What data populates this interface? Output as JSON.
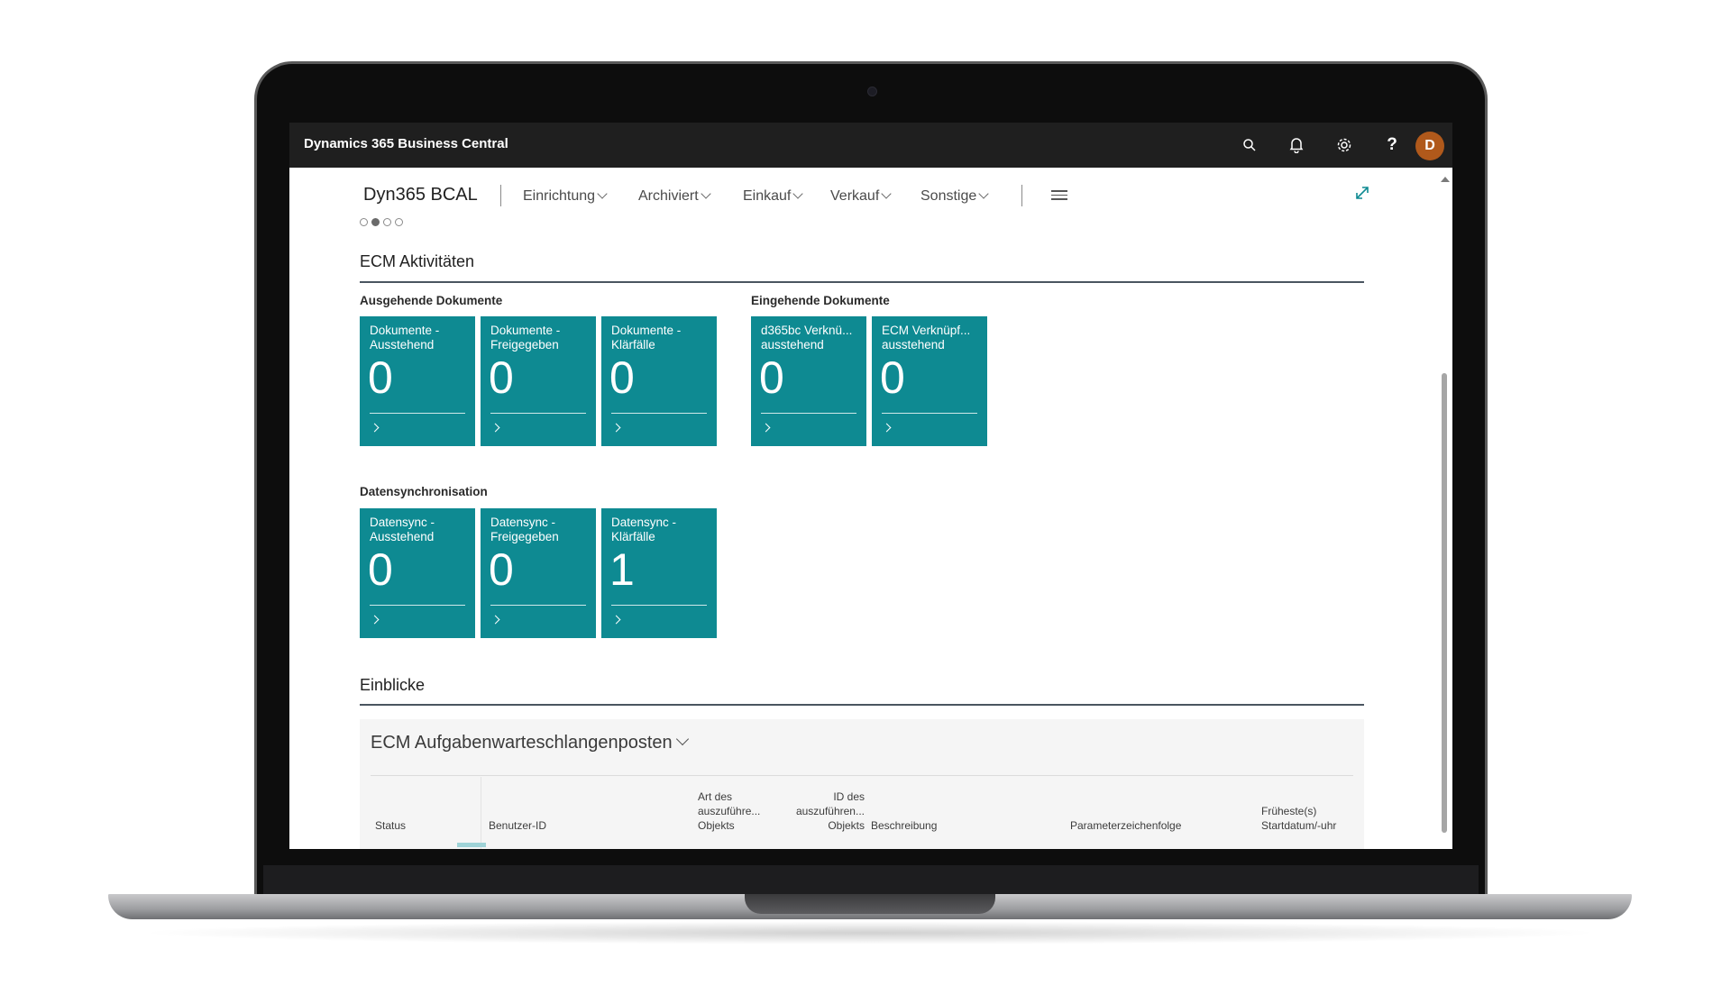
{
  "app": {
    "title": "Dynamics 365 Business Central",
    "avatar_initial": "D",
    "accent_tile": "#0e8a92",
    "header_bg": "#1f1f1f",
    "avatar_bg": "#b0591b"
  },
  "header_icons": [
    "search-icon",
    "bell-icon",
    "gear-icon",
    "help-icon"
  ],
  "nav": {
    "company": "Dyn365 BCAL",
    "items": [
      "Einrichtung",
      "Archiviert",
      "Einkauf",
      "Verkauf",
      "Sonstige"
    ],
    "page_dots": 4,
    "active_dot": 1
  },
  "ecm": {
    "title": "ECM Aktivitäten",
    "groups": [
      {
        "label": "Ausgehende Dokumente",
        "tiles": [
          {
            "label": "Dokumente -\nAusstehend",
            "value": "0"
          },
          {
            "label": "Dokumente -\nFreigegeben",
            "value": "0"
          },
          {
            "label": "Dokumente -\nKlärfälle",
            "value": "0"
          }
        ]
      },
      {
        "label": "Eingehende Dokumente",
        "tiles": [
          {
            "label": "d365bc Verknü...\nausstehend",
            "value": "0"
          },
          {
            "label": "ECM Verknüpf...\nausstehend",
            "value": "0"
          }
        ]
      },
      {
        "label": "Datensynchronisation",
        "tiles": [
          {
            "label": "Datensync -\nAusstehend",
            "value": "0"
          },
          {
            "label": "Datensync -\nFreigegeben",
            "value": "0"
          },
          {
            "label": "Datensync -\nKlärfälle",
            "value": "1"
          }
        ]
      }
    ]
  },
  "insights": {
    "title": "Einblicke",
    "card_title": "ECM Aufgabenwarteschlangenposten",
    "columns": [
      "Status",
      "Benutzer-ID",
      "Art des\nauszuführe...\nObjekts",
      "ID des\nauszuführen...\nObjekts",
      "Beschreibung",
      "Parameterzeichenfolge",
      "Früheste(s)\nStartdatum/-uhr"
    ]
  }
}
